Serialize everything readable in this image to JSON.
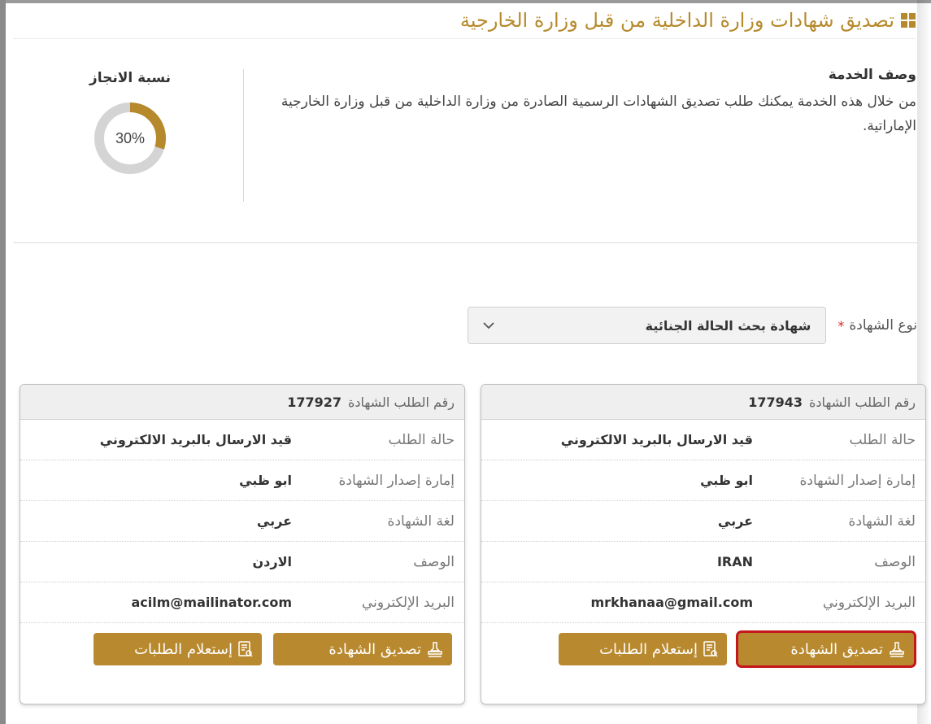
{
  "page": {
    "title": "تصديق شهادات وزارة الداخلية من قبل وزارة الخارجية",
    "title_icon": "grid-icon",
    "accent_color": "#b68a2c"
  },
  "description": {
    "heading": "وصف الخدمة",
    "text": "من خلال هذه الخدمة يمكنك طلب تصديق الشهادات الرسمية الصادرة من وزارة الداخلية من قبل وزارة الخارجية الإماراتية."
  },
  "progress": {
    "label": "نسبة الانجاز",
    "value_text": "30%",
    "value": 30
  },
  "certificate_type": {
    "label": "نوع الشهادة",
    "required_marker": "*",
    "selected": "شهادة بحث الحالة الجنائية"
  },
  "requests": [
    {
      "header_label": "رقم الطلب الشهادة",
      "number": "177943",
      "rows": [
        {
          "label": "حالة الطلب",
          "value": "قيد الارسال بالبريد الالكتروني"
        },
        {
          "label": "إمارة إصدار الشهادة",
          "value": "ابو ظبي"
        },
        {
          "label": "لغة الشهادة",
          "value": "عربي"
        },
        {
          "label": "الوصف",
          "value": "IRAN"
        },
        {
          "label": "البريد الإلكتروني",
          "value": "mrkhanaa@gmail.com"
        }
      ],
      "approve_label": "تصديق الشهادة",
      "inquiry_label": "إستعلام الطلبات"
    },
    {
      "header_label": "رقم الطلب الشهادة",
      "number": "177927",
      "rows": [
        {
          "label": "حالة الطلب",
          "value": "قيد الارسال بالبريد الالكتروني"
        },
        {
          "label": "إمارة إصدار الشهادة",
          "value": "ابو ظبي"
        },
        {
          "label": "لغة الشهادة",
          "value": "عربي"
        },
        {
          "label": "الوصف",
          "value": "الاردن"
        },
        {
          "label": "البريد الإلكتروني",
          "value": "acilm@mailinator.com"
        }
      ],
      "approve_label": "تصديق الشهادة",
      "inquiry_label": "إستعلام الطلبات"
    }
  ]
}
